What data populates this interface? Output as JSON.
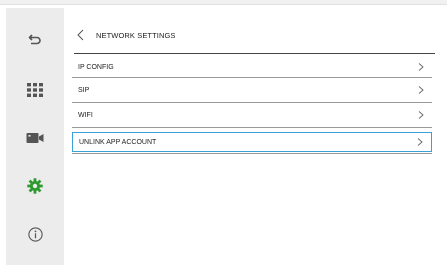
{
  "header": {
    "title": "NETWORK SETTINGS"
  },
  "menu": {
    "items": [
      {
        "label": "IP CONFIG"
      },
      {
        "label": "SIP"
      },
      {
        "label": "WIFI"
      },
      {
        "label": "UNLINK APP ACCOUNT",
        "selected": true
      }
    ]
  },
  "sidebar": {
    "items": [
      {
        "icon": "back-arrow-icon"
      },
      {
        "icon": "grid-apps-icon"
      },
      {
        "icon": "camera-icon"
      },
      {
        "icon": "gear-icon",
        "active": true
      },
      {
        "icon": "info-icon"
      }
    ]
  },
  "colors": {
    "sidebar_bg": "#ececec",
    "accent_green": "#2e9a2e",
    "selection_border": "#3aa0d8"
  }
}
